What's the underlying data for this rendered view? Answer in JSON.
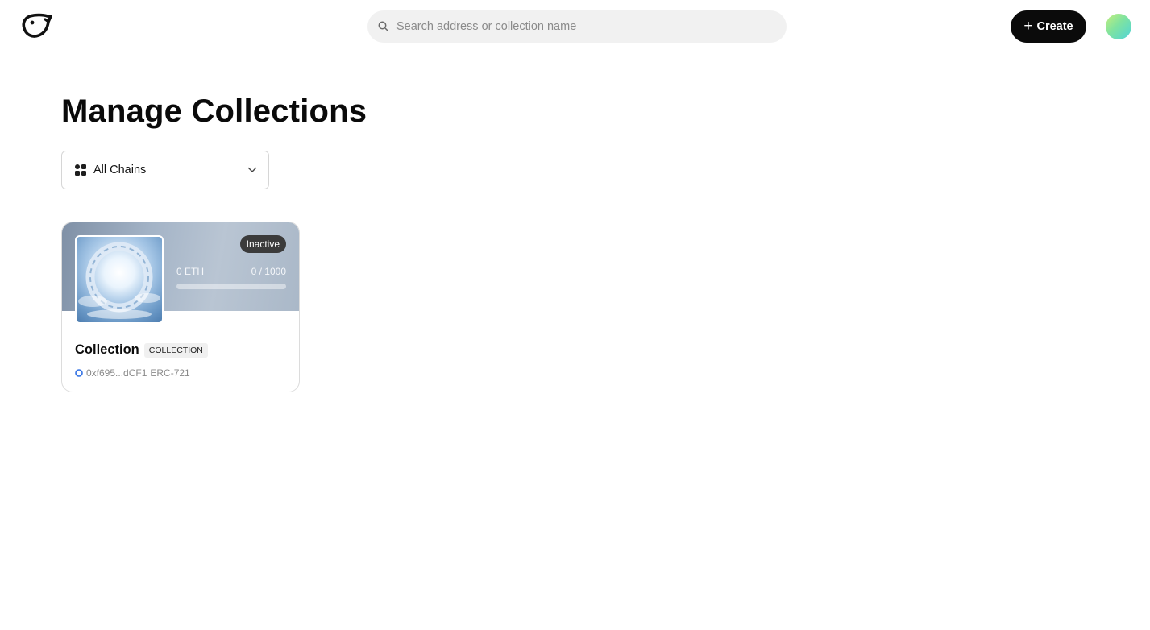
{
  "header": {
    "logo_icon": "bird-logo-icon",
    "search_placeholder": "Search address or collection name",
    "search_value": "",
    "create_label": "Create",
    "create_icon": "plus-icon",
    "avatar_gradient": [
      "#c6ef7c",
      "#4fd4d9"
    ]
  },
  "page": {
    "title": "Manage Collections"
  },
  "chain_filter": {
    "icon": "grid-icon",
    "selected": "All Chains",
    "chevron": "chevron-down-icon"
  },
  "collections": [
    {
      "status": "Inactive",
      "price": "0 ETH",
      "minted": "0 / 1000",
      "minted_fraction": 0,
      "name": "Collection",
      "type_tag": "COLLECTION",
      "address": "0xf695...dCF1",
      "standard": "ERC-721",
      "chain_icon": "chain-circle-icon",
      "chain_color": "#2f6fe4"
    }
  ],
  "colors": {
    "button_bg": "#0b0b0b",
    "badge_bg": "#3b3b3b",
    "search_bg": "#f1f1f1"
  }
}
